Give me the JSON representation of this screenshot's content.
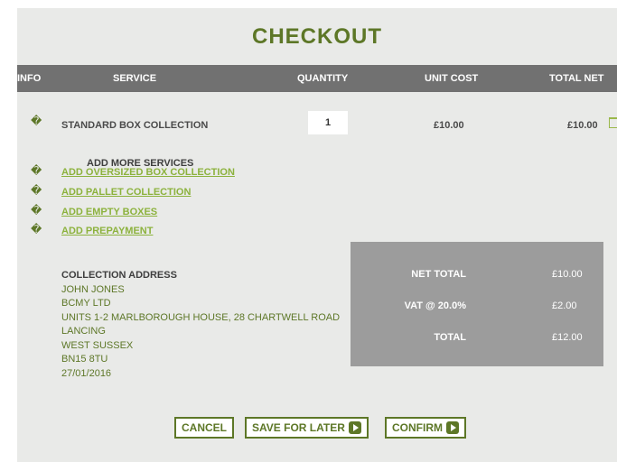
{
  "title": "CHECKOUT",
  "table": {
    "headers": {
      "info": "INFO",
      "service": "SERVICE",
      "quantity": "QUANTITY",
      "unit_cost": "UNIT COST",
      "total_net": "TOTAL NET"
    },
    "rows": [
      {
        "info_icon": "�",
        "service": "STANDARD BOX COLLECTION",
        "quantity": "1",
        "unit_cost": "£10.00",
        "total_net": "£10.00"
      }
    ]
  },
  "add_more": {
    "heading": "ADD MORE SERVICES",
    "items": [
      {
        "icon": "�",
        "label": "ADD OVERSIZED BOX COLLECTION"
      },
      {
        "icon": "�",
        "label": "ADD PALLET COLLECTION"
      },
      {
        "icon": "�",
        "label": "ADD EMPTY BOXES"
      },
      {
        "icon": "�",
        "label": "ADD PREPAYMENT"
      }
    ]
  },
  "address": {
    "label": "COLLECTION ADDRESS",
    "lines": [
      "JOHN JONES",
      "BCMY LTD",
      "UNITS 1-2 MARLBOROUGH HOUSE, 28 CHARTWELL ROAD",
      "LANCING",
      "WEST SUSSEX",
      "BN15 8TU",
      "27/01/2016"
    ]
  },
  "totals": {
    "net_label": "NET TOTAL",
    "net_value": "£10.00",
    "vat_label": "VAT @ 20.0%",
    "vat_value": "£2.00",
    "total_label": "TOTAL",
    "total_value": "£12.00"
  },
  "buttons": {
    "cancel": "CANCEL",
    "save_later": "SAVE FOR LATER",
    "confirm": "CONFIRM"
  },
  "colors": {
    "accent": "#5d7727",
    "link": "#8cb23d",
    "header_bg": "#717171",
    "totals_bg": "#9c9c9c",
    "panel_bg": "#e9eae8"
  }
}
